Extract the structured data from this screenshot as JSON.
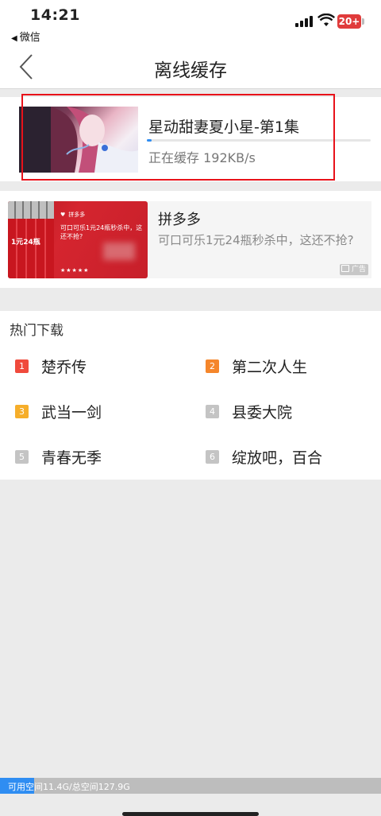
{
  "status_bar": {
    "time": "14:21",
    "back_app": "微信",
    "battery": "20+"
  },
  "nav": {
    "title": "离线缓存"
  },
  "download": {
    "title": "星动甜妻夏小星-第1集",
    "status": "正在缓存 192KB/s",
    "progress": 0.02
  },
  "ad": {
    "brand": "拼多多",
    "description": "可口可乐1元24瓶秒杀中，这还不抢?",
    "badge": "广告",
    "image_brand": "拼多多",
    "image_text": "可口可乐1元24瓶秒杀中，这还不抢?",
    "image_price": "1元24瓶"
  },
  "hot": {
    "title": "热门下载",
    "items": [
      {
        "rank": "1",
        "name": "楚乔传",
        "color": "#f04a3c"
      },
      {
        "rank": "2",
        "name": "第二次人生",
        "color": "#f5862b"
      },
      {
        "rank": "3",
        "name": "武当一剑",
        "color": "#f6ae2a"
      },
      {
        "rank": "4",
        "name": "县委大院",
        "color": "#c4c4c4"
      },
      {
        "rank": "5",
        "name": "青春无季",
        "color": "#c4c4c4"
      },
      {
        "rank": "6",
        "name": "绽放吧，百合",
        "color": "#c4c4c4"
      }
    ]
  },
  "storage": {
    "text": "可用空间11.4G/总空间127.9G",
    "used_fraction": 0.09
  },
  "colors": {
    "accent": "#2f8df2",
    "highlight": "#e8121a"
  }
}
